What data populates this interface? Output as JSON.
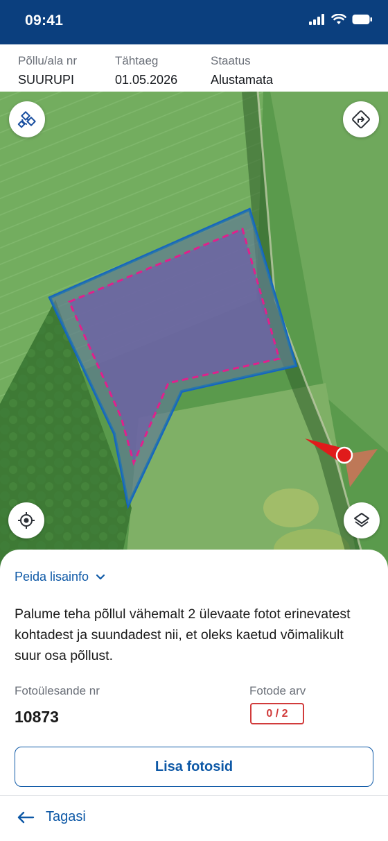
{
  "status_bar": {
    "time": "09:41",
    "icons": [
      "signal-icon",
      "wifi-icon",
      "battery-icon"
    ]
  },
  "field_info": {
    "field_label": "Põllu/ala nr",
    "field_value": "SUURUPI",
    "deadline_label": "Tähtaeg",
    "deadline_value": "01.05.2026",
    "status_label": "Staatus",
    "status_value": "Alustamata"
  },
  "map": {
    "controls": [
      "satellite-icon",
      "directions-icon",
      "locate-icon",
      "layers-icon"
    ],
    "colors": {
      "boundary": "#1565c0",
      "inner_boundary": "#e0208c",
      "field_fill": "#6f5fa8",
      "direction_marker": "#e01b1b"
    }
  },
  "sheet": {
    "toggle_label": "Peida lisainfo",
    "description": "Palume teha põllul vähemalt 2 ülevaate fotot erinevatest kohtadest ja suundadest nii, et oleks kaetud võimalikult suur osa põllust.",
    "task_label": "Fotoülesande nr",
    "task_number": "10873",
    "photos_label": "Fotode arv",
    "photos_count": "0 / 2",
    "add_button": "Lisa fotosid",
    "back_label": "Tagasi"
  },
  "colors": {
    "header": "#0b3f7e",
    "primary": "#0d58a6",
    "error": "#d13b3b"
  }
}
